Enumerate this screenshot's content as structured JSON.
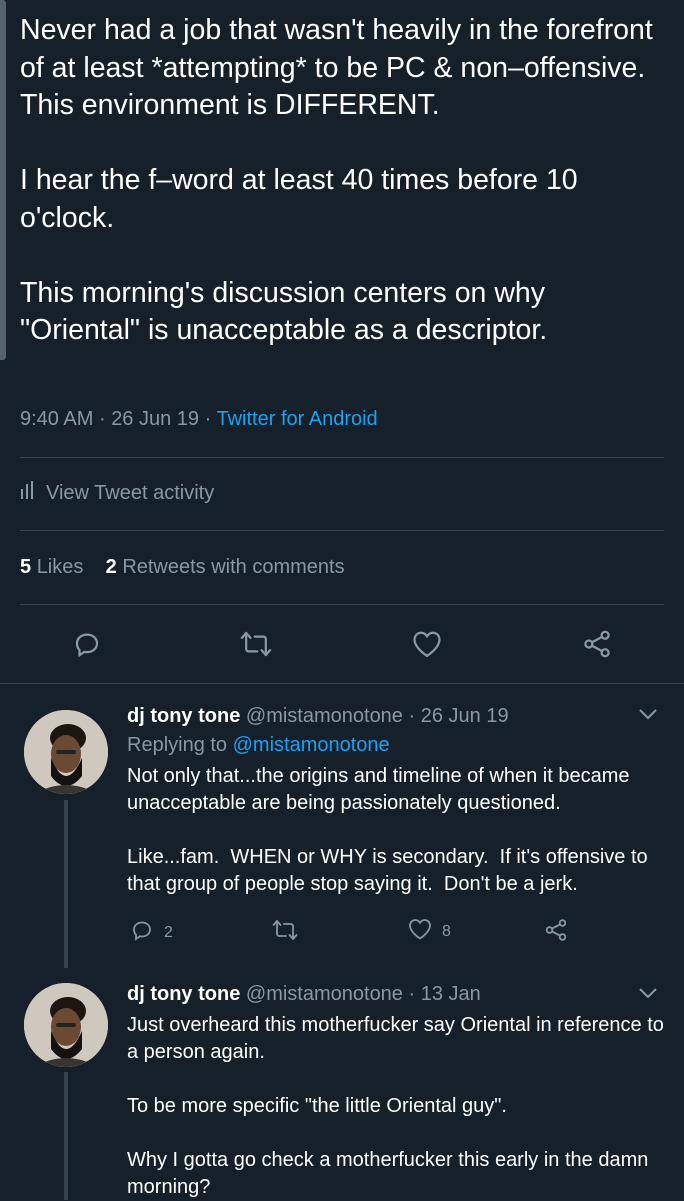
{
  "tweet": {
    "text": "Never had a job that wasn't heavily in the forefront of at least *attempting* to be PC & non–offensive.  This environment is DIFFERENT.\n\nI hear the f–word at least 40 times before 10 o'clock.\n\nThis morning's discussion centers on why \"Oriental\" is unacceptable as a descriptor.",
    "time": "9:40 AM",
    "date": "26 Jun 19",
    "separator": "·",
    "client": "Twitter for Android",
    "activity_label": "View Tweet activity",
    "likes_count": "5",
    "likes_label": "Likes",
    "retweets_count": "2",
    "retweets_label": "Retweets with comments"
  },
  "replies": [
    {
      "name": "dj tony tone",
      "handle": "@mistamonotone",
      "date": "· 26 Jun 19",
      "replying_prefix": "Replying to",
      "replying_to": "@mistamonotone",
      "text": "Not only that...the origins and timeline of when it became unacceptable are being passionately questioned.\n\nLike...fam.  WHEN or WHY is secondary.  If it's offensive to that group of people stop saying it.  Don't be a jerk.",
      "reply_count": "2",
      "like_count": "8"
    },
    {
      "name": "dj tony tone",
      "handle": "@mistamonotone",
      "date": "· 13 Jan",
      "text": "Just overheard this motherfucker say Oriental in reference to a person again.\n\nTo be more specific \"the little Oriental guy\".\n\nWhy I gotta go check a motherfucker this early in the damn morning?"
    }
  ],
  "colors": {
    "background": "#15202b",
    "text": "#ffffff",
    "secondary": "#8899a6",
    "accent": "#1da1f2",
    "divider": "#38444d"
  }
}
